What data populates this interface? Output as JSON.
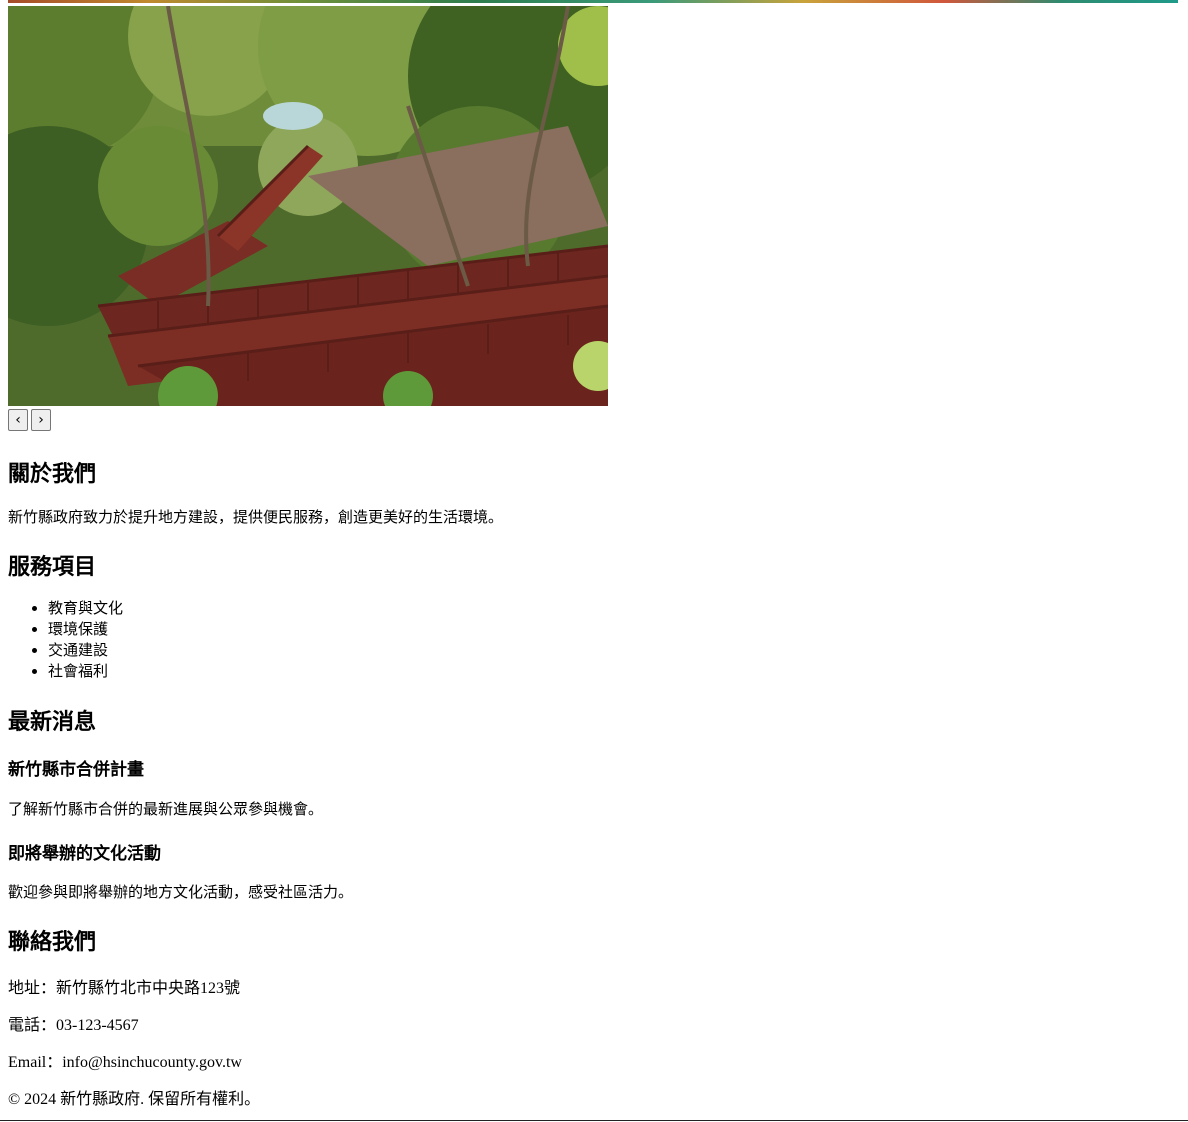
{
  "carousel": {
    "prev_label": "‹",
    "next_label": "›",
    "image_icon": "forest-stairway-photo"
  },
  "about": {
    "title": "關於我們",
    "text": "新竹縣政府致力於提升地方建設，提供便民服務，創造更美好的生活環境。"
  },
  "services": {
    "title": "服務項目",
    "items": [
      "教育與文化",
      "環境保護",
      "交通建設",
      "社會福利"
    ]
  },
  "news": {
    "title": "最新消息",
    "items": [
      {
        "title": "新竹縣市合併計畫",
        "text": "了解新竹縣市合併的最新進展與公眾參與機會。"
      },
      {
        "title": "即將舉辦的文化活動",
        "text": "歡迎參與即將舉辦的地方文化活動，感受社區活力。"
      }
    ]
  },
  "contact": {
    "title": "聯絡我們",
    "address": "地址：新竹縣竹北市中央路123號",
    "phone": "電話：03-123-4567",
    "email": "Email：info@hsinchucounty.gov.tw"
  },
  "footer": {
    "copyright": "© 2024 新竹縣政府. 保留所有權利。"
  }
}
